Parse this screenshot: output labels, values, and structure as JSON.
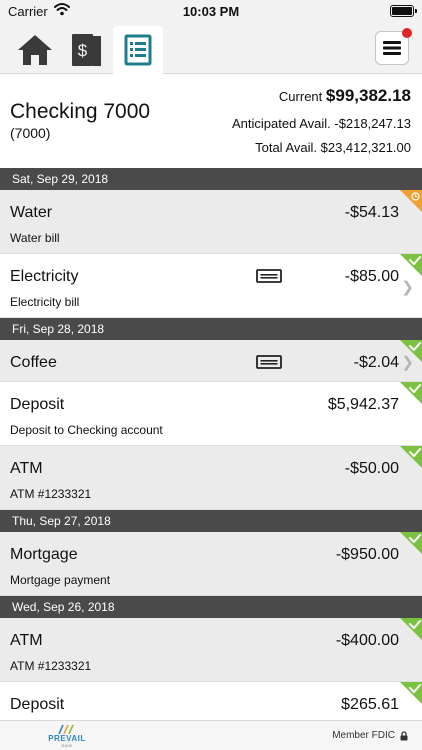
{
  "status_bar": {
    "carrier": "Carrier",
    "time": "10:03 PM"
  },
  "tabs": [
    {
      "name": "home",
      "icon": "home-icon"
    },
    {
      "name": "money",
      "icon": "cash-icon"
    },
    {
      "name": "register",
      "icon": "register-icon",
      "selected": true
    }
  ],
  "menu": {
    "icon": "hamburger-icon",
    "has_notification": true
  },
  "account": {
    "name": "Checking 7000",
    "number": "(7000)",
    "current_label": "Current",
    "current_value": "$99,382.18",
    "anticipated": "Anticipated Avail. -$218,247.13",
    "total": "Total Avail. $23,412,321.00"
  },
  "groups": [
    {
      "date": "Sat, Sep 29, 2018",
      "transactions": [
        {
          "title": "Water",
          "desc": "Water bill",
          "amount": "-$54.13",
          "status": "pending",
          "memo": false,
          "chevron": false
        },
        {
          "title": "Electricity",
          "desc": "Electricity bill",
          "amount": "-$85.00",
          "status": "cleared",
          "memo": true,
          "chevron": true
        }
      ]
    },
    {
      "date": "Fri, Sep 28, 2018",
      "transactions": [
        {
          "title": "Coffee",
          "desc": "",
          "amount": "-$2.04",
          "status": "cleared",
          "memo": true,
          "chevron": true
        },
        {
          "title": "Deposit",
          "desc": "Deposit to Checking account",
          "amount": "$5,942.37",
          "status": "cleared",
          "memo": false,
          "chevron": false
        },
        {
          "title": "ATM",
          "desc": "ATM #1233321",
          "amount": "-$50.00",
          "status": "cleared",
          "memo": false,
          "chevron": false
        }
      ]
    },
    {
      "date": "Thu, Sep 27, 2018",
      "transactions": [
        {
          "title": "Mortgage",
          "desc": "Mortgage payment",
          "amount": "-$950.00",
          "status": "cleared",
          "memo": false,
          "chevron": false
        }
      ]
    },
    {
      "date": "Wed, Sep 26, 2018",
      "transactions": [
        {
          "title": "ATM",
          "desc": "ATM #1233321",
          "amount": "-$400.00",
          "status": "cleared",
          "memo": false,
          "chevron": false
        },
        {
          "title": "Deposit",
          "desc": "",
          "amount": "$265.61",
          "status": "cleared",
          "memo": false,
          "chevron": false
        }
      ]
    }
  ],
  "footer": {
    "brand": "PREVAIL",
    "brand_sub": "BANK",
    "fdic": "Member FDIC"
  },
  "colors": {
    "cleared": "#7cc242",
    "pending": "#f0a030",
    "date_bar": "#4a4a4a",
    "register_accent": "#1e7f8c"
  }
}
